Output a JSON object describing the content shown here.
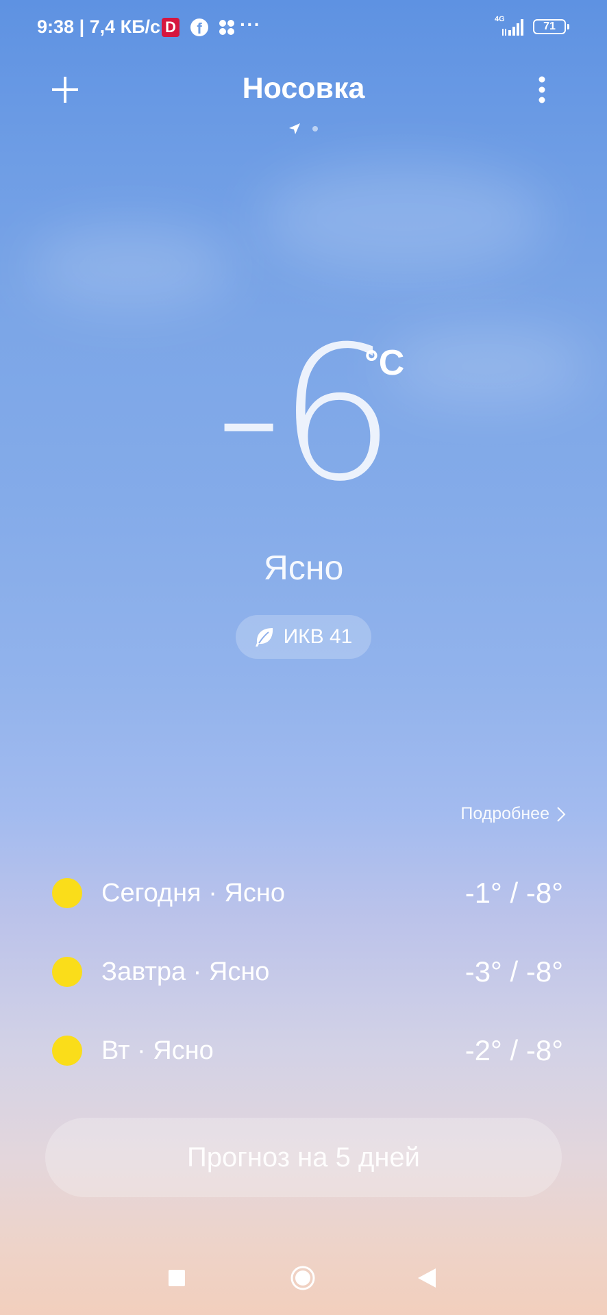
{
  "status_bar": {
    "time": "9:38",
    "speed": "| 7,4 КБ/с",
    "notif_d": "D",
    "notif_fb": "f",
    "more_dots": "···",
    "network": "4G",
    "battery": "71"
  },
  "header": {
    "city": "Носовка",
    "add_icon": "plus-icon",
    "menu_icon": "vertical-dots-icon",
    "page_indicator": {
      "active_icon": "location-arrow-icon",
      "pages": 2,
      "current": 1
    }
  },
  "current": {
    "temperature": "-6",
    "unit": "°C",
    "condition": "Ясно",
    "aqi_label": "ИКВ 41",
    "aqi_icon": "leaf-icon"
  },
  "details_link": "Подробнее",
  "daily": [
    {
      "label": "Сегодня · Ясно",
      "range": "-1° / -8°",
      "icon": "sun-icon"
    },
    {
      "label": "Завтра · Ясно",
      "range": "-3° / -8°",
      "icon": "sun-icon"
    },
    {
      "label": "Вт · Ясно",
      "range": "-2° / -8°",
      "icon": "sun-icon"
    }
  ],
  "forecast_button": "Прогноз на 5 дней",
  "colors": {
    "sky_top": "#5e92e2",
    "sky_bottom": "#f2cfbd",
    "sun": "#fadd1a"
  }
}
